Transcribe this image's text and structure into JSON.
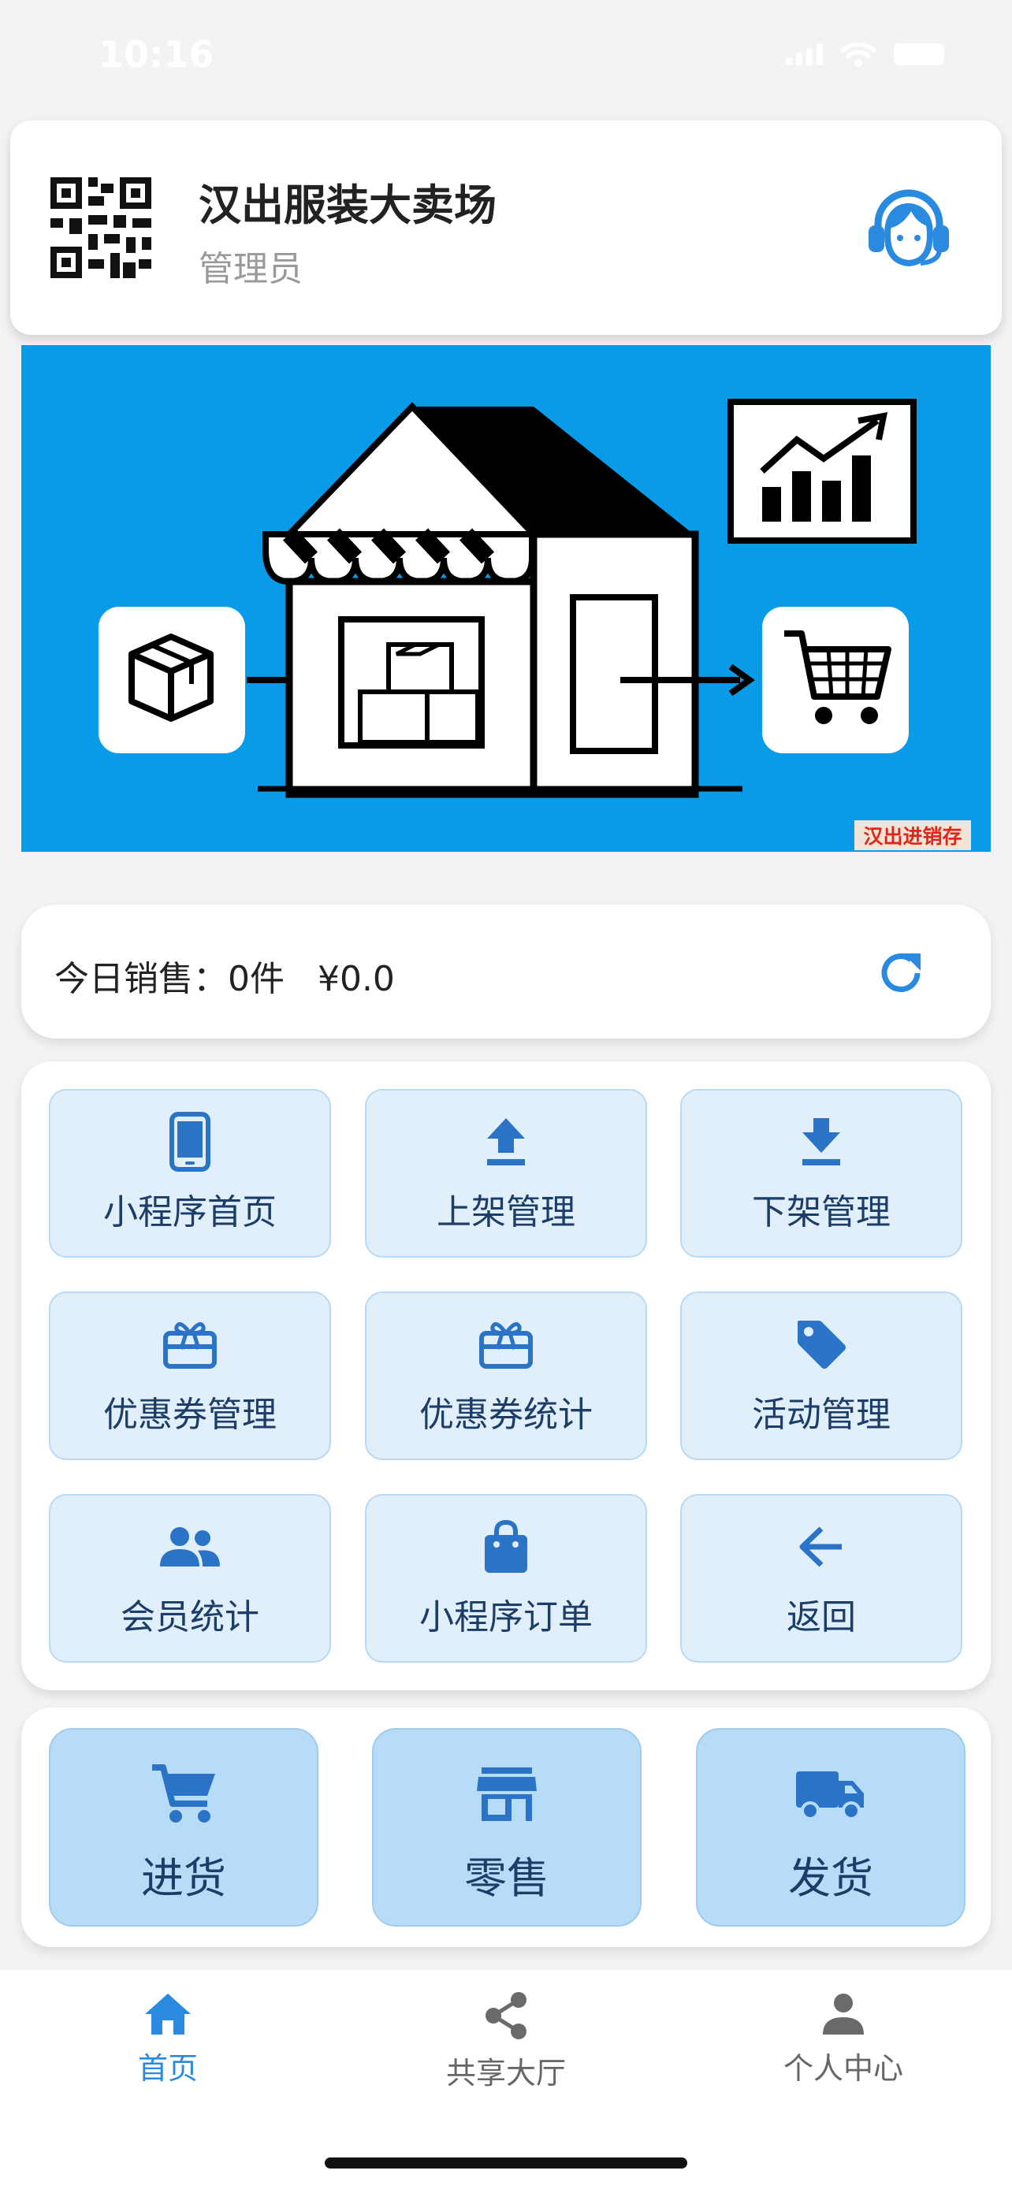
{
  "status": {
    "time": "10:16"
  },
  "header": {
    "store_name": "汉出服装大卖场",
    "role": "管理员",
    "icons": {
      "qr": "qr-code-icon",
      "service": "customer-service-icon"
    }
  },
  "banner": {
    "tag": "汉出进销存",
    "icons": [
      "box-icon",
      "store-icon",
      "chart-icon",
      "cart-icon"
    ],
    "background": "#0a9be8"
  },
  "sales": {
    "summary": "今日销售：0件   ¥0.0",
    "icon": "refresh-icon"
  },
  "grid": {
    "items": [
      {
        "label": "小程序首页",
        "icon": "phone-icon"
      },
      {
        "label": "上架管理",
        "icon": "upload-icon"
      },
      {
        "label": "下架管理",
        "icon": "download-icon"
      },
      {
        "label": "优惠券管理",
        "icon": "coupon-icon"
      },
      {
        "label": "优惠券统计",
        "icon": "coupon-icon"
      },
      {
        "label": "活动管理",
        "icon": "tag-icon"
      },
      {
        "label": "会员统计",
        "icon": "members-icon"
      },
      {
        "label": "小程序订单",
        "icon": "bag-icon"
      },
      {
        "label": "返回",
        "icon": "arrow-left-icon"
      }
    ]
  },
  "actions": {
    "items": [
      {
        "label": "进货",
        "icon": "cart-icon"
      },
      {
        "label": "零售",
        "icon": "storefront-icon"
      },
      {
        "label": "发货",
        "icon": "truck-icon"
      }
    ]
  },
  "tabbar": {
    "items": [
      {
        "label": "首页",
        "icon": "home-icon",
        "active": true
      },
      {
        "label": "共享大厅",
        "icon": "share-icon",
        "active": false
      },
      {
        "label": "个人中心",
        "icon": "person-icon",
        "active": false
      }
    ]
  },
  "colors": {
    "accent": "#2a8ae0",
    "tile_bg": "#e1effb",
    "action_bg": "#b7dcf7",
    "inactive": "#666666"
  }
}
